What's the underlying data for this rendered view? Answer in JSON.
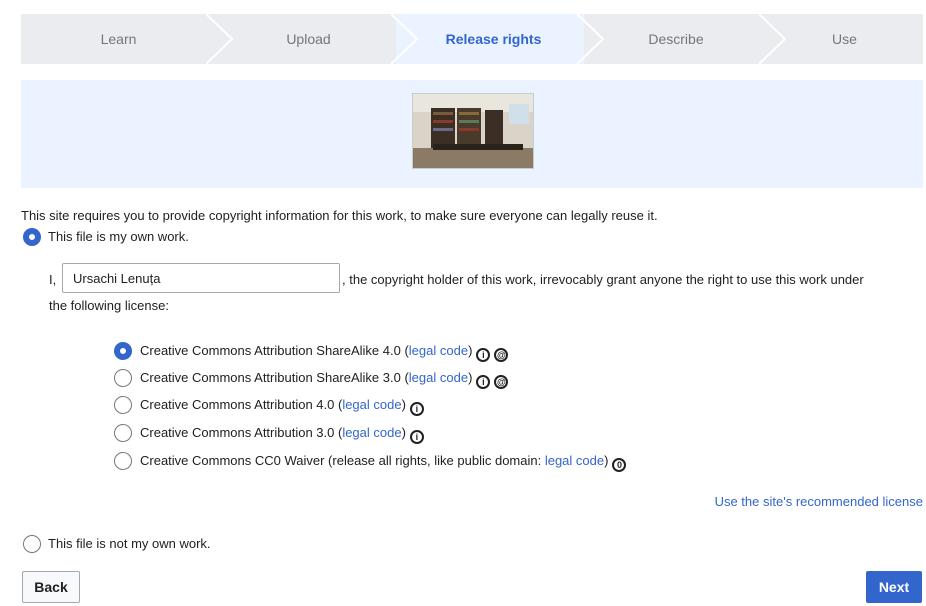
{
  "steps": [
    "Learn",
    "Upload",
    "Release rights",
    "Describe",
    "Use"
  ],
  "intro_text": "This site requires you to provide copyright information for this work, to make sure everyone can legally reuse it.",
  "own_work": {
    "label": "This file is my own work.",
    "prefix": "I,",
    "author_value": "Ursachi Lenuța",
    "statement_line1": ", the copyright holder of this work, irrevocably grant anyone the right to use this work under",
    "statement_line2": "the following license:"
  },
  "licenses": [
    {
      "label": "Creative Commons Attribution ShareAlike 4.0 (",
      "link": "legal code",
      "suffix": ")",
      "selected": true,
      "icons": [
        "by-icon",
        "sa-icon"
      ]
    },
    {
      "label": "Creative Commons Attribution ShareAlike 3.0 (",
      "link": "legal code",
      "suffix": ")",
      "selected": false,
      "icons": [
        "by-icon",
        "sa-icon"
      ]
    },
    {
      "label": "Creative Commons Attribution 4.0 (",
      "link": "legal code",
      "suffix": ")",
      "selected": false,
      "icons": [
        "by-icon"
      ]
    },
    {
      "label": "Creative Commons Attribution 3.0 (",
      "link": "legal code",
      "suffix": ")",
      "selected": false,
      "icons": [
        "by-icon"
      ]
    },
    {
      "label": "Creative Commons CC0 Waiver (release all rights, like public domain: ",
      "link": "legal code",
      "suffix": ")",
      "selected": false,
      "icons": [
        "zero-icon"
      ]
    }
  ],
  "recommended_link": "Use the site's recommended license",
  "not_own_work": {
    "label": "This file is not my own work."
  },
  "buttons": {
    "back": "Back",
    "next": "Next"
  },
  "colors": {
    "accent": "#3366cc",
    "step_bg": "#eaecf0",
    "preview_bg": "#eaf3ff"
  }
}
